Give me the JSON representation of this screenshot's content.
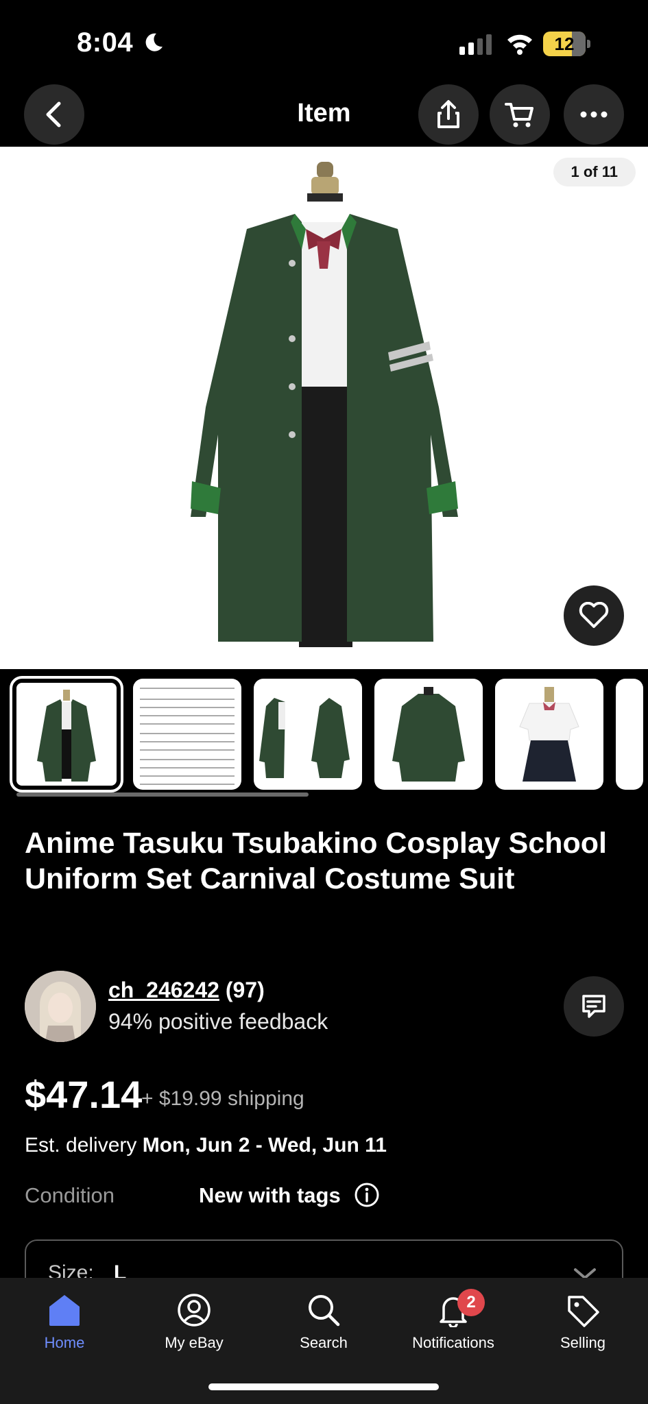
{
  "status_bar": {
    "time": "8:04",
    "battery": "12"
  },
  "nav": {
    "title": "Item"
  },
  "gallery": {
    "counter": "1 of 11"
  },
  "listing": {
    "title": "Anime Tasuku Tsubakino Cosplay School Uniform Set Carnival Costume Suit",
    "seller": {
      "name": "ch_246242",
      "rating_count": "(97)",
      "feedback": "94% positive feedback"
    },
    "price": "$47.14",
    "shipping": "+ $19.99 shipping",
    "delivery": {
      "label": "Est. delivery",
      "range": "Mon, Jun 2 - Wed, Jun 11"
    },
    "condition": {
      "label": "Condition",
      "value": "New with tags"
    },
    "size": {
      "label": "Size:",
      "value": "L"
    }
  },
  "tabbar": {
    "items": [
      {
        "label": "Home",
        "icon": "home-icon",
        "active": true
      },
      {
        "label": "My eBay",
        "icon": "account-icon"
      },
      {
        "label": "Search",
        "icon": "search-icon"
      },
      {
        "label": "Notifications",
        "icon": "bell-icon",
        "badge": "2"
      },
      {
        "label": "Selling",
        "icon": "tag-icon"
      }
    ]
  },
  "colors": {
    "accent": "#6f8eff",
    "badge": "#e0474c",
    "battery": "#f4d24a",
    "coat": "#2f4a33"
  }
}
